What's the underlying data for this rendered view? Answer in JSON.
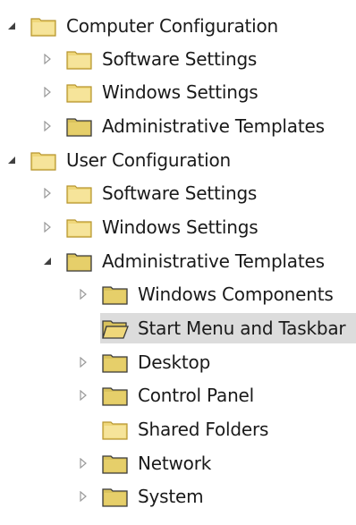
{
  "tree": {
    "nodes": [
      {
        "label": "Computer Configuration",
        "state": "expanded",
        "icon": "folder-icon"
      },
      {
        "label": "Software Settings",
        "state": "collapsed",
        "icon": "folder-icon"
      },
      {
        "label": "Windows Settings",
        "state": "collapsed",
        "icon": "folder-icon"
      },
      {
        "label": "Administrative Templates",
        "state": "collapsed",
        "icon": "folder-icon"
      },
      {
        "label": "User Configuration",
        "state": "expanded",
        "icon": "folder-icon"
      },
      {
        "label": "Software Settings",
        "state": "collapsed",
        "icon": "folder-icon"
      },
      {
        "label": "Windows Settings",
        "state": "collapsed",
        "icon": "folder-icon"
      },
      {
        "label": "Administrative Templates",
        "state": "expanded",
        "icon": "folder-icon"
      },
      {
        "label": "Windows Components",
        "state": "collapsed",
        "icon": "folder-icon"
      },
      {
        "label": "Start Menu and Taskbar",
        "state": "leaf",
        "icon": "open-folder-icon",
        "selected": true
      },
      {
        "label": "Desktop",
        "state": "collapsed",
        "icon": "folder-icon"
      },
      {
        "label": "Control Panel",
        "state": "collapsed",
        "icon": "folder-icon"
      },
      {
        "label": "Shared Folders",
        "state": "leaf",
        "icon": "folder-icon"
      },
      {
        "label": "Network",
        "state": "collapsed",
        "icon": "folder-icon"
      },
      {
        "label": "System",
        "state": "collapsed",
        "icon": "folder-icon"
      }
    ]
  },
  "colors": {
    "folder_fill": "#efd77a",
    "folder_stroke": "#b6952e",
    "folder_dark_fill": "#d9c25c",
    "folder_dark_stroke": "#3a3a3a",
    "arrow_collapsed": "#9a9a9a",
    "arrow_expanded": "#404040",
    "selection": "#dcdcdc"
  }
}
